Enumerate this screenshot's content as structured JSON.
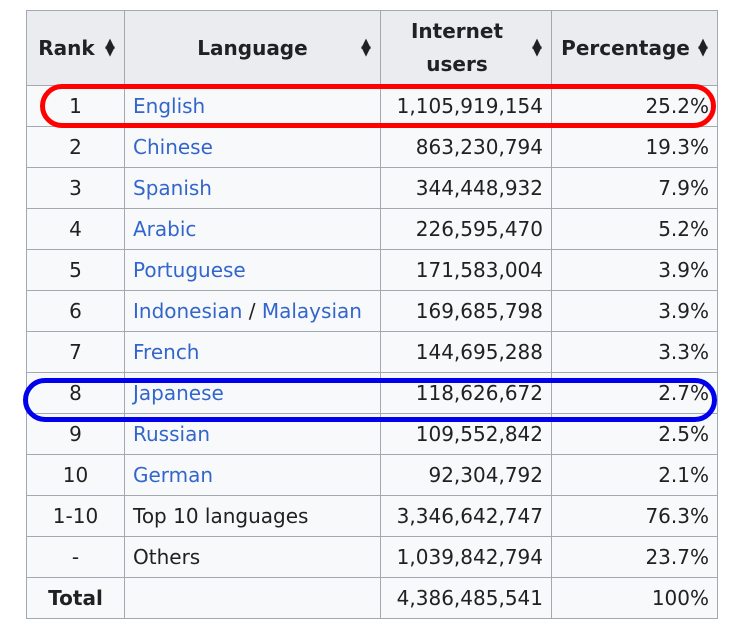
{
  "table": {
    "headers": {
      "rank": "Rank",
      "language": "Language",
      "internet_users_line1": "Internet",
      "internet_users_line2": "users",
      "percentage": "Percentage"
    },
    "rows": [
      {
        "rank": "1",
        "language": "English",
        "users": "1,105,919,154",
        "pct": "25.2%"
      },
      {
        "rank": "2",
        "language": "Chinese",
        "users": "863,230,794",
        "pct": "19.3%"
      },
      {
        "rank": "3",
        "language": "Spanish",
        "users": "344,448,932",
        "pct": "7.9%"
      },
      {
        "rank": "4",
        "language": "Arabic",
        "users": "226,595,470",
        "pct": "5.2%"
      },
      {
        "rank": "5",
        "language": "Portuguese",
        "users": "171,583,004",
        "pct": "3.9%"
      },
      {
        "rank": "6",
        "language_a": "Indonesian",
        "separator": " / ",
        "language_b": "Malaysian",
        "users": "169,685,798",
        "pct": "3.9%"
      },
      {
        "rank": "7",
        "language": "French",
        "users": "144,695,288",
        "pct": "3.3%"
      },
      {
        "rank": "8",
        "language": "Japanese",
        "users": "118,626,672",
        "pct": "2.7%"
      },
      {
        "rank": "9",
        "language": "Russian",
        "users": "109,552,842",
        "pct": "2.5%"
      },
      {
        "rank": "10",
        "language": "German",
        "users": "92,304,792",
        "pct": "2.1%"
      },
      {
        "rank": "1-10",
        "language": "Top 10 languages",
        "users": "3,346,642,747",
        "pct": "76.3%"
      },
      {
        "rank": "-",
        "language": "Others",
        "users": "1,039,842,794",
        "pct": "23.7%"
      }
    ],
    "total": {
      "label": "Total",
      "users": "4,386,485,541",
      "pct": "100%"
    }
  },
  "colors": {
    "link": "#3366cc",
    "header_bg": "#eaecf0",
    "cell_bg": "#f8f9fa",
    "border": "#a2a9b1",
    "highlight_english": "#ff0000",
    "highlight_japanese": "#0000ee"
  },
  "icons": {
    "sort": "sort-arrows-icon"
  }
}
